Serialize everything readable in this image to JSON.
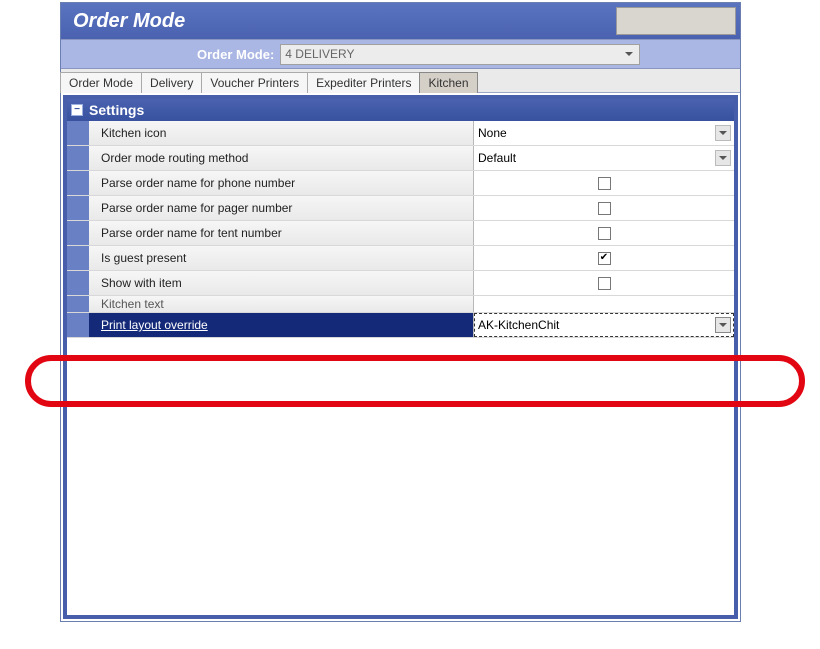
{
  "window_title": "Order Mode",
  "selector": {
    "label": "Order Mode:",
    "value": "4 DELIVERY"
  },
  "tabs": [
    "Order Mode",
    "Delivery",
    "Voucher Printers",
    "Expediter Printers",
    "Kitchen"
  ],
  "active_tab_index": 4,
  "section_title": "Settings",
  "settings": {
    "kitchen_icon": {
      "label": "Kitchen icon",
      "value": "None"
    },
    "routing_method": {
      "label": "Order mode routing method",
      "value": "Default"
    },
    "parse_phone": {
      "label": "Parse order name for phone number",
      "checked": false
    },
    "parse_pager": {
      "label": "Parse order name for pager number",
      "checked": false
    },
    "parse_tent": {
      "label": "Parse order name for tent number",
      "checked": false
    },
    "is_guest_present": {
      "label": "Is guest present",
      "checked": true
    },
    "show_with_item": {
      "label": "Show with item",
      "checked": false
    },
    "kitchen_text": {
      "label": "Kitchen text",
      "value": ""
    },
    "print_layout_override": {
      "label": "Print layout override",
      "value": "AK-KitchenChit"
    }
  }
}
